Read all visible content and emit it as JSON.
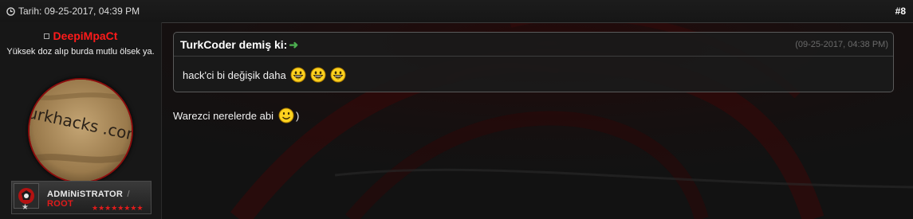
{
  "header": {
    "date_text": "Tarih: 09-25-2017, 04:39 PM",
    "post_number": "#8"
  },
  "user": {
    "username": "DeepiMpaCt",
    "title": "Yüksek doz alıp burda mutlu ölsek ya.",
    "avatar_graffiti": "turkhacks .com",
    "rank_main": "ADMiNiSTRATOR",
    "rank_sep": "/",
    "rank_sub": "ROOT",
    "rank_stars": "★★★★★★★★",
    "rank_small_star": "★"
  },
  "quote": {
    "author": "TurkCoder demiş ki:",
    "arrow": "➜",
    "time": "(09-25-2017, 04:38 PM)",
    "text": "hack'ci bi değişik daha"
  },
  "post": {
    "text": "Warezci nerelerde abi",
    "after_smiley": ")"
  },
  "colors": {
    "username": "#ff1a1a",
    "rank_root": "#e01b1b",
    "quote_arrow": "#4caf50"
  },
  "icons": [
    "clock-icon",
    "online-status-icon",
    "grin-smiley-icon",
    "smile-smiley-icon",
    "arrow-right-icon",
    "star-icon",
    "rank-logo-icon"
  ]
}
